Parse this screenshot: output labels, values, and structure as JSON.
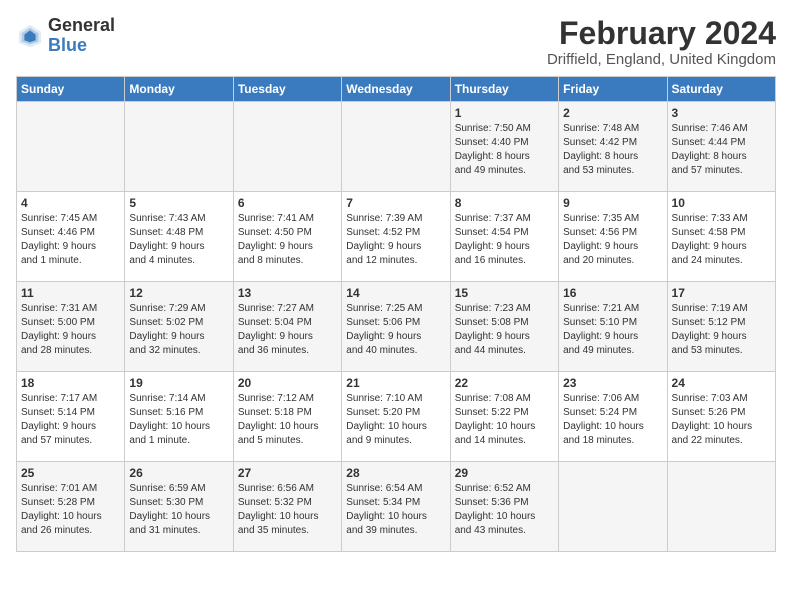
{
  "header": {
    "logo": {
      "general": "General",
      "blue": "Blue"
    },
    "title": "February 2024",
    "location": "Driffield, England, United Kingdom"
  },
  "weekdays": [
    "Sunday",
    "Monday",
    "Tuesday",
    "Wednesday",
    "Thursday",
    "Friday",
    "Saturday"
  ],
  "weeks": [
    [
      {
        "day": "",
        "info": ""
      },
      {
        "day": "",
        "info": ""
      },
      {
        "day": "",
        "info": ""
      },
      {
        "day": "",
        "info": ""
      },
      {
        "day": "1",
        "info": "Sunrise: 7:50 AM\nSunset: 4:40 PM\nDaylight: 8 hours\nand 49 minutes."
      },
      {
        "day": "2",
        "info": "Sunrise: 7:48 AM\nSunset: 4:42 PM\nDaylight: 8 hours\nand 53 minutes."
      },
      {
        "day": "3",
        "info": "Sunrise: 7:46 AM\nSunset: 4:44 PM\nDaylight: 8 hours\nand 57 minutes."
      }
    ],
    [
      {
        "day": "4",
        "info": "Sunrise: 7:45 AM\nSunset: 4:46 PM\nDaylight: 9 hours\nand 1 minute."
      },
      {
        "day": "5",
        "info": "Sunrise: 7:43 AM\nSunset: 4:48 PM\nDaylight: 9 hours\nand 4 minutes."
      },
      {
        "day": "6",
        "info": "Sunrise: 7:41 AM\nSunset: 4:50 PM\nDaylight: 9 hours\nand 8 minutes."
      },
      {
        "day": "7",
        "info": "Sunrise: 7:39 AM\nSunset: 4:52 PM\nDaylight: 9 hours\nand 12 minutes."
      },
      {
        "day": "8",
        "info": "Sunrise: 7:37 AM\nSunset: 4:54 PM\nDaylight: 9 hours\nand 16 minutes."
      },
      {
        "day": "9",
        "info": "Sunrise: 7:35 AM\nSunset: 4:56 PM\nDaylight: 9 hours\nand 20 minutes."
      },
      {
        "day": "10",
        "info": "Sunrise: 7:33 AM\nSunset: 4:58 PM\nDaylight: 9 hours\nand 24 minutes."
      }
    ],
    [
      {
        "day": "11",
        "info": "Sunrise: 7:31 AM\nSunset: 5:00 PM\nDaylight: 9 hours\nand 28 minutes."
      },
      {
        "day": "12",
        "info": "Sunrise: 7:29 AM\nSunset: 5:02 PM\nDaylight: 9 hours\nand 32 minutes."
      },
      {
        "day": "13",
        "info": "Sunrise: 7:27 AM\nSunset: 5:04 PM\nDaylight: 9 hours\nand 36 minutes."
      },
      {
        "day": "14",
        "info": "Sunrise: 7:25 AM\nSunset: 5:06 PM\nDaylight: 9 hours\nand 40 minutes."
      },
      {
        "day": "15",
        "info": "Sunrise: 7:23 AM\nSunset: 5:08 PM\nDaylight: 9 hours\nand 44 minutes."
      },
      {
        "day": "16",
        "info": "Sunrise: 7:21 AM\nSunset: 5:10 PM\nDaylight: 9 hours\nand 49 minutes."
      },
      {
        "day": "17",
        "info": "Sunrise: 7:19 AM\nSunset: 5:12 PM\nDaylight: 9 hours\nand 53 minutes."
      }
    ],
    [
      {
        "day": "18",
        "info": "Sunrise: 7:17 AM\nSunset: 5:14 PM\nDaylight: 9 hours\nand 57 minutes."
      },
      {
        "day": "19",
        "info": "Sunrise: 7:14 AM\nSunset: 5:16 PM\nDaylight: 10 hours\nand 1 minute."
      },
      {
        "day": "20",
        "info": "Sunrise: 7:12 AM\nSunset: 5:18 PM\nDaylight: 10 hours\nand 5 minutes."
      },
      {
        "day": "21",
        "info": "Sunrise: 7:10 AM\nSunset: 5:20 PM\nDaylight: 10 hours\nand 9 minutes."
      },
      {
        "day": "22",
        "info": "Sunrise: 7:08 AM\nSunset: 5:22 PM\nDaylight: 10 hours\nand 14 minutes."
      },
      {
        "day": "23",
        "info": "Sunrise: 7:06 AM\nSunset: 5:24 PM\nDaylight: 10 hours\nand 18 minutes."
      },
      {
        "day": "24",
        "info": "Sunrise: 7:03 AM\nSunset: 5:26 PM\nDaylight: 10 hours\nand 22 minutes."
      }
    ],
    [
      {
        "day": "25",
        "info": "Sunrise: 7:01 AM\nSunset: 5:28 PM\nDaylight: 10 hours\nand 26 minutes."
      },
      {
        "day": "26",
        "info": "Sunrise: 6:59 AM\nSunset: 5:30 PM\nDaylight: 10 hours\nand 31 minutes."
      },
      {
        "day": "27",
        "info": "Sunrise: 6:56 AM\nSunset: 5:32 PM\nDaylight: 10 hours\nand 35 minutes."
      },
      {
        "day": "28",
        "info": "Sunrise: 6:54 AM\nSunset: 5:34 PM\nDaylight: 10 hours\nand 39 minutes."
      },
      {
        "day": "29",
        "info": "Sunrise: 6:52 AM\nSunset: 5:36 PM\nDaylight: 10 hours\nand 43 minutes."
      },
      {
        "day": "",
        "info": ""
      },
      {
        "day": "",
        "info": ""
      }
    ]
  ]
}
